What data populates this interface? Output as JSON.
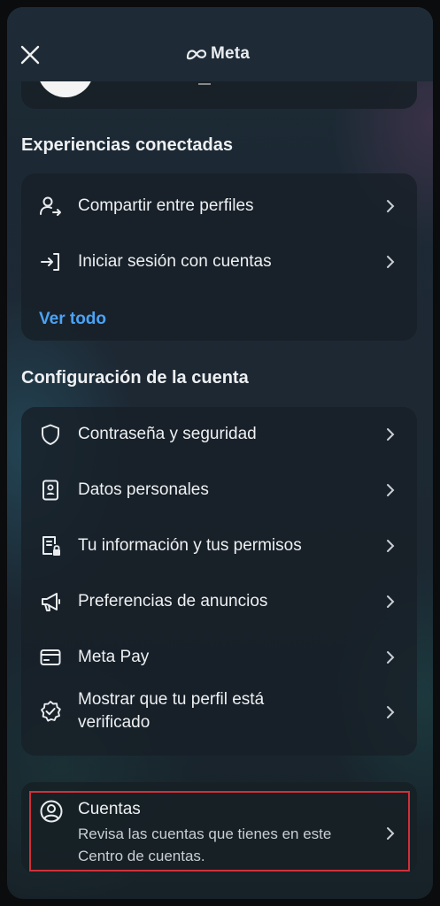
{
  "header": {
    "brand": "Meta"
  },
  "connected": {
    "title": "Experiencias conectadas",
    "items": [
      {
        "label": "Compartir entre perfiles",
        "icon": "share-profiles-icon"
      },
      {
        "label": "Iniciar sesión con cuentas",
        "icon": "login-icon"
      }
    ],
    "see_all": "Ver todo"
  },
  "account_settings": {
    "title": "Configuración de la cuenta",
    "items": [
      {
        "label": "Contraseña y seguridad",
        "icon": "shield-icon"
      },
      {
        "label": "Datos personales",
        "icon": "id-card-icon"
      },
      {
        "label": "Tu información y tus permisos",
        "icon": "document-lock-icon"
      },
      {
        "label": "Preferencias de anuncios",
        "icon": "megaphone-icon"
      },
      {
        "label": "Meta Pay",
        "icon": "card-icon"
      },
      {
        "label": "Mostrar que tu perfil está",
        "label_line2": "verificado",
        "icon": "verified-badge-icon"
      }
    ]
  },
  "accounts": {
    "title": "Cuentas",
    "subtitle": "Revisa las cuentas que tienes en este Centro de cuentas.",
    "icon": "user-circle-icon"
  },
  "colors": {
    "link": "#4ba3f5",
    "highlight": "#d0303a"
  }
}
